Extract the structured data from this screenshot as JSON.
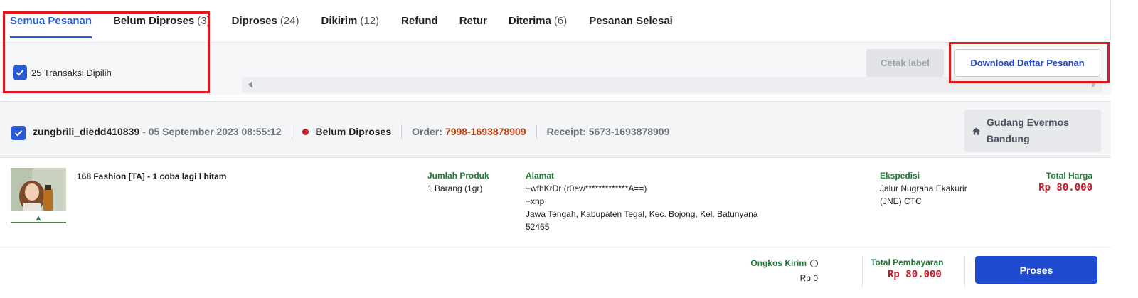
{
  "tabs": [
    {
      "label": "Semua Pesanan",
      "count": ""
    },
    {
      "label": "Belum Diproses",
      "count": "(3)"
    },
    {
      "label": "Diproses",
      "count": "(24)"
    },
    {
      "label": "Dikirim",
      "count": "(12)"
    },
    {
      "label": "Refund",
      "count": ""
    },
    {
      "label": "Retur",
      "count": ""
    },
    {
      "label": "Diterima",
      "count": "(6)"
    },
    {
      "label": "Pesanan Selesai",
      "count": ""
    }
  ],
  "active_tab": "Semua Pesanan",
  "selection": {
    "label": "25 Transaksi Dipilih",
    "checked": true
  },
  "actions": {
    "cetak_label": "Cetak label",
    "download_label": "Download Daftar Pesanan"
  },
  "order": {
    "checked": true,
    "username": "zungbrili_diedd410839",
    "date": "- 05 September 2023 08:55:12",
    "status": "Belum Diproses",
    "order_label": "Order:",
    "order_id": "7998-1693878909",
    "receipt": "Receipt: 5673-1693878909",
    "warehouse": "Gudang Evermos Bandung",
    "product_name": "168 Fashion [TA] - 1 coba lagi l hitam",
    "jumlah_label": "Jumlah Produk",
    "jumlah_value": "1 Barang (1gr)",
    "alamat_label": "Alamat",
    "alamat_lines": [
      "+wfhKrDr (r0ew*************A==)",
      "+xnp",
      "Jawa Tengah, Kabupaten Tegal, Kec. Bojong, Kel. Batunyana",
      "52465"
    ],
    "ekspedisi_label": "Ekspedisi",
    "ekspedisi_lines": [
      "Jalur Nugraha Ekakurir",
      "(JNE) CTC"
    ],
    "total_harga_label": "Total Harga",
    "total_harga": "Rp 80.000",
    "ongkos_label": "Ongkos Kirim",
    "ongkos_value": "Rp 0",
    "total_bayar_label": "Total Pembayaran",
    "total_bayar": "Rp 80.000",
    "proses_label": "Proses"
  },
  "colors": {
    "accent": "#2a5bd7",
    "highlight_box": "#e2141e",
    "price": "#c0212c",
    "green_label": "#1f7a36",
    "primary_button": "#1f4bd1"
  }
}
